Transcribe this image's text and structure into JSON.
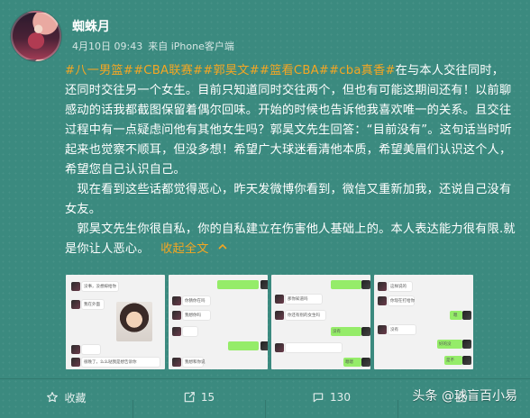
{
  "post": {
    "username": "蜘蛛月",
    "date": "4月10日 09:43",
    "source_prefix": "来自",
    "source": "iPhone客户端",
    "tags": [
      "#八一男篮#",
      "#CBA联赛#",
      "#郭昊文#",
      "#篮看CBA#",
      "#cba真香#"
    ],
    "paragraph_1_after_tags": "在与本人交往同时，还同时交往另一个女生。目前只知道同时交往两个，但也有可能这期间还有！以前聊感动的话我都截图保留着偶尔回味。开始的时候也告诉他我喜欢唯一的关系。且交往过程中有一点疑虑问他有其他女生吗？郭昊文先生回答：“目前没有”。这句话当时听起来也觉察不顺耳，但没多想！希望广大球迷看清他本质，希望美眉们认识这个人，希望您自己认识自己。",
    "paragraph_2": "现在看到这些话都觉得恶心，昨天发微博你看到，微信又重新加我，还说自己没有女友。",
    "paragraph_3": "郭昊文先生你很自私，你的自私建立在伤害他人基础上的。本人表达能力很有限.就是你让人恶心。",
    "collapse_label": "收起全文"
  },
  "thumbnails": [
    {
      "texts": [
        "没事，没想嫁给你",
        "我在外面",
        "很晚了，么么哒我是想告诉你"
      ]
    },
    {
      "texts": [
        "你猜你在吗",
        "我想你吗",
        "我想和你说"
      ]
    },
    {
      "texts": [
        "那你知道吗",
        "你还有别的女生吗",
        "没有",
        "嗯嗯"
      ]
    },
    {
      "texts": [
        "这样说的",
        "你现在打给你",
        "嗯",
        "没有",
        "好的没",
        "是不"
      ]
    }
  ],
  "actions": {
    "favorite_label": "收藏",
    "repost_count": "15",
    "comment_count": "130",
    "like_count": ""
  },
  "watermark": "头条 @球盲百小易",
  "colors": {
    "background": "#3b8a7f",
    "tag": "#f4a623",
    "text": "#ffffff"
  }
}
